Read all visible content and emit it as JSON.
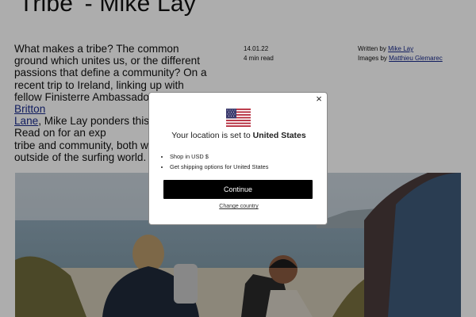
{
  "article": {
    "title": "'Tribe' - Mike Lay",
    "intro_part1": "What makes a tribe? The common ground which unites us, or the different passions that define a community? On a recent trip to Ireland, linking up with fellow Finisterre Ambassadors ",
    "intro_link": "Easkey Britton",
    "intro_part2_obscured": "",
    "intro_link2": "Lane",
    "intro_part3": ", Mike Lay ponders this question. Read on for an exp",
    "intro_part4": "tribe and community, both wi",
    "intro_part5": "outside of the surfing world.",
    "date": "14.01.22",
    "read_time": "4 min read",
    "written_by_label": "Written by ",
    "author": "Mike Lay",
    "images_by_label": "Images by ",
    "photographer": "Matthieu Glemarec"
  },
  "modal": {
    "location_prefix": "Your location is set to ",
    "location_country": "United States",
    "bullet_1": "Shop in USD $",
    "bullet_2": "Get shipping options for United States",
    "continue_label": "Continue",
    "change_country_label": "Change country",
    "close_glyph": "×",
    "flag_icon": "us-flag-icon"
  },
  "colors": {
    "overlay": "rgba(0,0,0,0.32)",
    "button_bg": "#000000",
    "link": "#1a2b8c"
  }
}
